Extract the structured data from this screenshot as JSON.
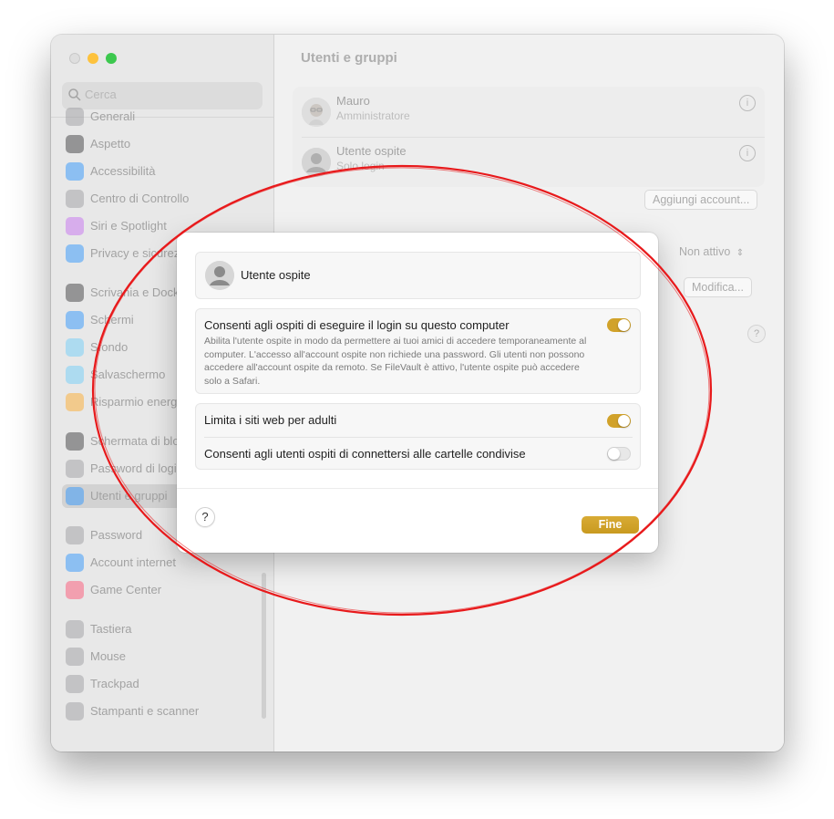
{
  "window": {
    "title": "Utenti e gruppi",
    "search_placeholder": "Cerca"
  },
  "sidebar": {
    "items": [
      {
        "label": "Generali",
        "icon": "gear-icon",
        "color": "#8e8e93"
      },
      {
        "label": "Aspetto",
        "icon": "appearance-icon",
        "color": "#1c1c1e"
      },
      {
        "label": "Accessibilità",
        "icon": "accessibility-icon",
        "color": "#0a84ff"
      },
      {
        "label": "Centro di Controllo",
        "icon": "control-center-icon",
        "color": "#8e8e93"
      },
      {
        "label": "Siri e Spotlight",
        "icon": "siri-icon",
        "color": "#bf5af2"
      },
      {
        "label": "Privacy e sicurezza",
        "icon": "hand-icon",
        "color": "#0a84ff"
      },
      {
        "label": "Scrivania e Dock",
        "icon": "dock-icon",
        "color": "#1c1c1e"
      },
      {
        "label": "Schermi",
        "icon": "display-icon",
        "color": "#0a84ff"
      },
      {
        "label": "Sfondo",
        "icon": "wallpaper-icon",
        "color": "#5ac8fa"
      },
      {
        "label": "Salvaschermo",
        "icon": "screensaver-icon",
        "color": "#5ac8fa"
      },
      {
        "label": "Risparmio energia",
        "icon": "battery-icon",
        "color": "#ff9f0a"
      },
      {
        "label": "Schermata di blocco",
        "icon": "lock-icon",
        "color": "#1c1c1e"
      },
      {
        "label": "Password di login",
        "icon": "key-icon",
        "color": "#8e8e93"
      },
      {
        "label": "Utenti e gruppi",
        "icon": "users-icon",
        "color": "#0a84ff"
      },
      {
        "label": "Password",
        "icon": "password-key-icon",
        "color": "#8e8e93"
      },
      {
        "label": "Account internet",
        "icon": "at-icon",
        "color": "#0a84ff"
      },
      {
        "label": "Game Center",
        "icon": "game-center-icon",
        "color": "#ff375f"
      },
      {
        "label": "Tastiera",
        "icon": "keyboard-icon",
        "color": "#8e8e93"
      },
      {
        "label": "Mouse",
        "icon": "mouse-icon",
        "color": "#8e8e93"
      },
      {
        "label": "Trackpad",
        "icon": "trackpad-icon",
        "color": "#8e8e93"
      },
      {
        "label": "Stampanti e scanner",
        "icon": "printer-icon",
        "color": "#8e8e93"
      }
    ]
  },
  "main": {
    "users": [
      {
        "name": "Mauro",
        "role": "Amministratore"
      },
      {
        "name": "Utente ospite",
        "role": "Solo login"
      }
    ],
    "add_account_label": "Aggiungi account...",
    "auto_login_value": "Non attivo",
    "edit_label": "Modifica...",
    "help_label": "?"
  },
  "dialog": {
    "header_name": "Utente ospite",
    "allow_guest_title": "Consenti agli ospiti di eseguire il login su questo computer",
    "allow_guest_desc": "Abilita l'utente ospite in modo da permettere ai tuoi amici di accedere temporaneamente al computer. L'accesso all'account ospite non richiede una password. Gli utenti non possono accedere all'account ospite da remoto. Se FileVault è attivo, l'utente ospite può accedere solo a Safari.",
    "allow_guest_on": true,
    "limit_adult_title": "Limita i siti web per adulti",
    "limit_adult_on": true,
    "shared_folders_title": "Consenti agli utenti ospiti di connettersi alle cartelle condivise",
    "shared_folders_on": false,
    "help_label": "?",
    "done_label": "Fine",
    "accent_color": "#d1a22a"
  },
  "annotation": {
    "color": "#e8191b"
  }
}
